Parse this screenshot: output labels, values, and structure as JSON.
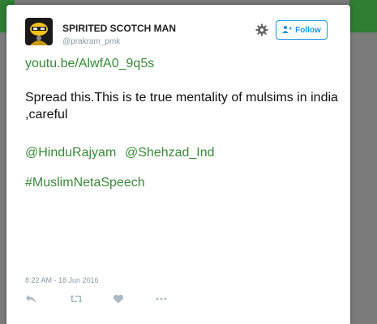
{
  "tweet": {
    "author": {
      "display_name": "SPIRITED SCOTCH MAN",
      "handle": "@prakram_pmk"
    },
    "follow_label": "Follow",
    "link": "youtu.be/AlwfA0_9q5s",
    "text": "Spread this.This is te true mentality of mulsims in india ,careful",
    "mentions": [
      "@HinduRajyam",
      "@Shehzad_Ind"
    ],
    "hashtag": "#MuslimNetaSpeech",
    "timestamp": "8:22 AM - 18 Jun 2016"
  },
  "icons": {
    "settings": "gear-icon",
    "follow": "add-user-icon",
    "reply": "reply-icon",
    "retweet": "retweet-icon",
    "like": "heart-icon",
    "more": "more-icon"
  },
  "colors": {
    "link": "#3a8a3a",
    "follow_accent": "#1b95e0",
    "backdrop": "#7b7b7b",
    "header_bar": "#2e7d32"
  }
}
